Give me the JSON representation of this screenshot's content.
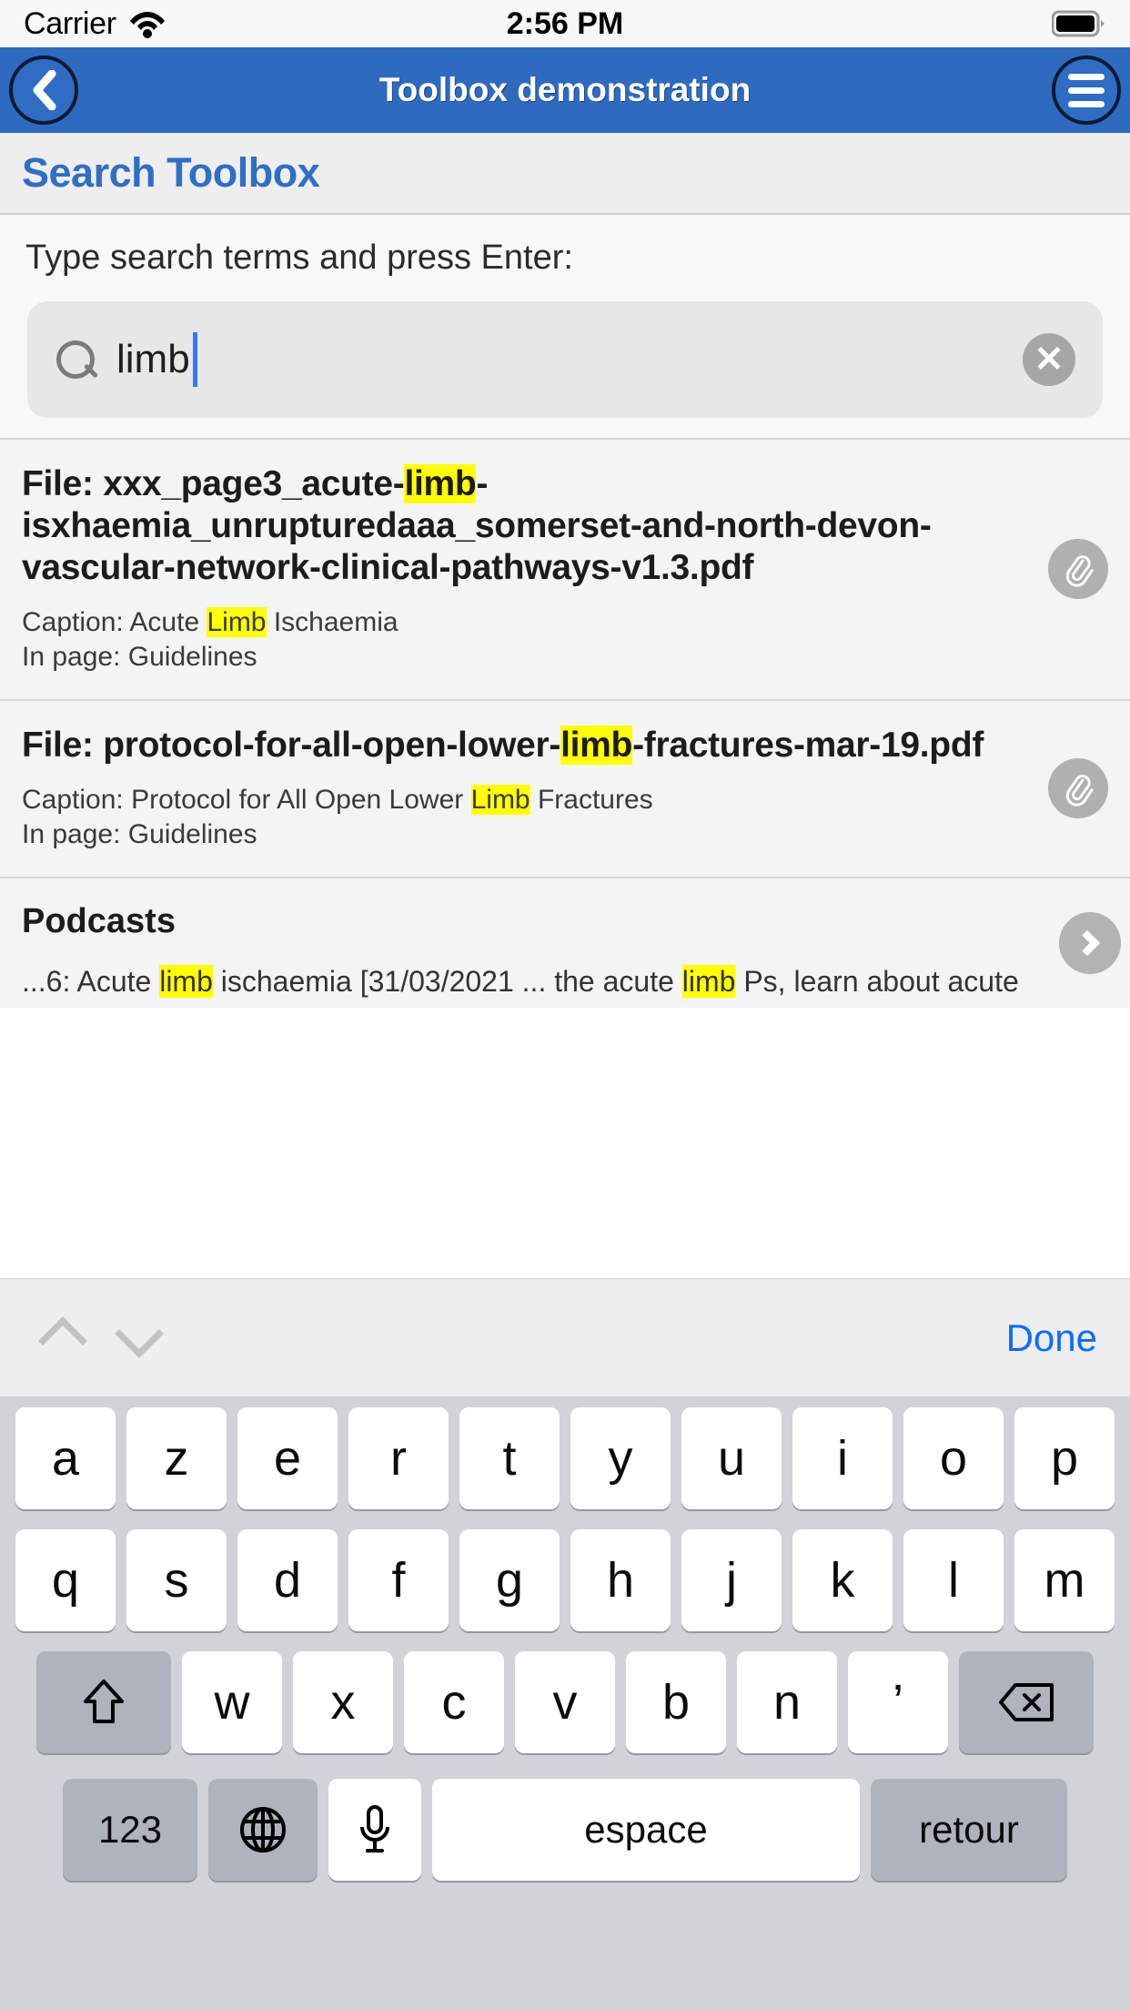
{
  "statusbar": {
    "carrier": "Carrier",
    "time": "2:56 PM",
    "wifi_icon": "wifi-icon",
    "battery_icon": "battery-full-icon"
  },
  "navbar": {
    "title": "Toolbox demonstration",
    "back_icon": "chevron-left-icon",
    "menu_icon": "hamburger-menu-icon"
  },
  "page": {
    "heading": "Search Toolbox",
    "instruction": "Type search terms and press Enter:"
  },
  "search": {
    "value": "limb",
    "placeholder": "Search",
    "search_icon": "search-icon",
    "clear_icon": "clear-circle-icon",
    "clear_glyph": "✕"
  },
  "results": [
    {
      "kind": "file",
      "title_prefix": "File: xxx_page3_acute-",
      "title_highlight": "limb",
      "title_suffix": "-isxhaemia_unrupturedaaa_somerset-and-north-devon-vascular-network-clinical-pathways-v1.3.pdf",
      "caption_prefix": "Caption: Acute ",
      "caption_highlight": "Limb",
      "caption_suffix": " Ischaemia",
      "inpage": "In page: Guidelines",
      "badge_icon": "paperclip-icon"
    },
    {
      "kind": "file",
      "title_prefix": "File: protocol-for-all-open-lower-",
      "title_highlight": "limb",
      "title_suffix": "-fractures-mar-19.pdf",
      "caption_prefix": "Caption: Protocol for All Open Lower ",
      "caption_highlight": "Limb",
      "caption_suffix": " Fractures",
      "inpage": "In page: Guidelines",
      "badge_icon": "paperclip-icon"
    }
  ],
  "podcasts": {
    "title": "Podcasts",
    "snippet_1": "...6: Acute ",
    "snippet_hl_1": "limb",
    "snippet_2": " ischaemia [31/03/2021 ... the acute ",
    "snippet_hl_2": "limb",
    "snippet_3": " Ps, learn about acute",
    "chevron_icon": "chevron-right-icon"
  },
  "accessory": {
    "prev_icon": "chevron-up-icon",
    "next_icon": "chevron-down-icon",
    "done_label": "Done"
  },
  "keyboard": {
    "layout": "azerty-fr",
    "row1": [
      "a",
      "z",
      "e",
      "r",
      "t",
      "y",
      "u",
      "i",
      "o",
      "p"
    ],
    "row2": [
      "q",
      "s",
      "d",
      "f",
      "g",
      "h",
      "j",
      "k",
      "l",
      "m"
    ],
    "row3_letters": [
      "w",
      "x",
      "c",
      "v",
      "b",
      "n",
      "’"
    ],
    "shift_icon": "shift-arrow-icon",
    "backspace_icon": "backspace-icon",
    "numeric_label": "123",
    "globe_icon": "globe-icon",
    "mic_icon": "microphone-icon",
    "space_label": "espace",
    "return_label": "retour"
  },
  "colors": {
    "navbar_blue": "#2e6ac0",
    "heading_blue": "#2f6fc4",
    "highlight_yellow": "#ffff00",
    "done_blue": "#0b6cff",
    "keyboard_bg": "#d1d3d9"
  }
}
